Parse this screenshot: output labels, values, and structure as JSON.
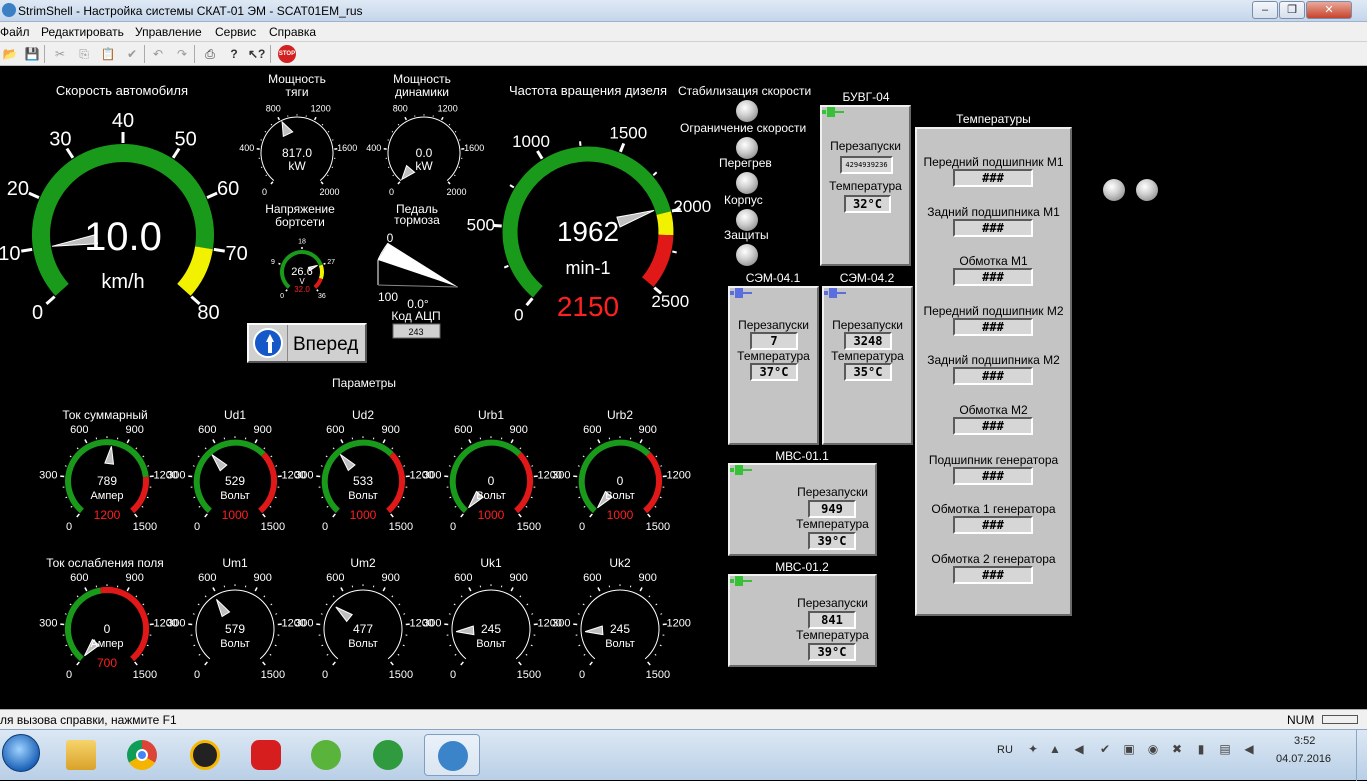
{
  "window": {
    "title": "StrimShell - Настройка системы СКАТ-01 ЭМ - SCAT01EM_rus",
    "controls": [
      "–",
      "❐",
      "✕"
    ]
  },
  "menu": [
    "Файл",
    "Редактировать",
    "Управление",
    "Сервис",
    "Справка"
  ],
  "toolbar": [
    "open-icon",
    "save-icon",
    "cut-icon",
    "copy-icon",
    "paste-icon",
    "check-icon",
    "undo-icon",
    "redo-icon",
    "print-icon",
    "help-icon",
    "context-help-icon",
    "stop-icon"
  ],
  "speed": {
    "title": "Скорость автомобиля",
    "value": "10.0",
    "unit": "km/h",
    "ticks": [
      "0",
      "10",
      "20",
      "30",
      "40",
      "50",
      "60",
      "70",
      "80"
    ]
  },
  "traction_power": {
    "title1": "Мощность",
    "title2": "тяги",
    "value": "817.0",
    "unit": "kW",
    "ticks": [
      "0",
      "400",
      "800",
      "1200",
      "1600",
      "2000"
    ]
  },
  "dynamic_power": {
    "title1": "Мощность",
    "title2": "динамики",
    "value": "0.0",
    "unit": "kW",
    "ticks": [
      "0",
      "400",
      "800",
      "1200",
      "1600",
      "2000"
    ]
  },
  "board_voltage": {
    "title1": "Напряжение",
    "title2": "бортсети",
    "value": "26.6",
    "unit": "V",
    "limit": "32.0",
    "ticks": [
      "0",
      "9",
      "18",
      "27",
      "36"
    ]
  },
  "brake_pedal": {
    "title1": "Педаль",
    "title2": "тормоза",
    "angle": "0.0°",
    "adc_label": "Код АЦП",
    "adc_value": "243",
    "ticks": [
      "0",
      "100"
    ]
  },
  "direction": {
    "label": "Вперед"
  },
  "diesel": {
    "title": "Частота вращения дизеля",
    "value": "1962",
    "unit": "min-1",
    "limit": "2150",
    "ticks": [
      "0",
      "500",
      "1000",
      "1500",
      "2000",
      "2500"
    ]
  },
  "stabilization": {
    "items": [
      "Стабилизация скорости",
      "Ограничение скорости",
      "Перегрев",
      "Корпус",
      "Защиты"
    ]
  },
  "buvg": {
    "title": "БУВГ-04",
    "restarts_label": "Перезапуски",
    "restarts": "4294939236",
    "temp_label": "Температура",
    "temp": "32°C"
  },
  "sem1": {
    "title": "СЭМ-04.1",
    "restarts_label": "Перезапуски",
    "restarts": "7",
    "temp_label": "Температура",
    "temp": "37°C"
  },
  "sem2": {
    "title": "СЭМ-04.2",
    "restarts_label": "Перезапуски",
    "restarts": "3248",
    "temp_label": "Температура",
    "temp": "35°C"
  },
  "mvs1": {
    "title": "МВС-01.1",
    "restarts_label": "Перезапуски",
    "restarts": "949",
    "temp_label": "Температура",
    "temp": "39°C"
  },
  "mvs2": {
    "title": "МВС-01.2",
    "restarts_label": "Перезапуски",
    "restarts": "841",
    "temp_label": "Температура",
    "temp": "39°C"
  },
  "temperatures": {
    "title": "Температуры",
    "items": [
      {
        "label": "Передний подшипник М1",
        "value": "###"
      },
      {
        "label": "Задний подшипника М1",
        "value": "###"
      },
      {
        "label": "Обмотка М1",
        "value": "###"
      },
      {
        "label": "Передний подшипник М2",
        "value": "###"
      },
      {
        "label": "Задний подшипника М2",
        "value": "###"
      },
      {
        "label": "Обмотка М2",
        "value": "###"
      },
      {
        "label": "Подшипник генератора",
        "value": "###"
      },
      {
        "label": "Обмотка 1 генератора",
        "value": "###"
      },
      {
        "label": "Обмотка 2 генератора",
        "value": "###"
      }
    ]
  },
  "params_title": "Параметры",
  "small_gauges": [
    {
      "title": "Ток суммарный",
      "value": "789",
      "unit": "Ампер",
      "limit": "1200",
      "ticks": [
        "0",
        "300",
        "600",
        "900",
        "1200",
        "1500"
      ]
    },
    {
      "title": "Ud1",
      "value": "529",
      "unit": "Вольт",
      "limit": "1000",
      "ticks": [
        "0",
        "300",
        "600",
        "900",
        "1200",
        "1500"
      ]
    },
    {
      "title": "Ud2",
      "value": "533",
      "unit": "Вольт",
      "limit": "1000",
      "ticks": [
        "0",
        "300",
        "600",
        "900",
        "1200",
        "1500"
      ]
    },
    {
      "title": "Urb1",
      "value": "0",
      "unit": "Вольт",
      "limit": "1000",
      "ticks": [
        "0",
        "300",
        "600",
        "900",
        "1200",
        "1500"
      ]
    },
    {
      "title": "Urb2",
      "value": "0",
      "unit": "Вольт",
      "limit": "1000",
      "ticks": [
        "0",
        "300",
        "600",
        "900",
        "1200",
        "1500"
      ]
    },
    {
      "title": "Ток ослабления поля",
      "value": "0",
      "unit": "Ампер",
      "limit": "700",
      "ticks": [
        "0",
        "300",
        "600",
        "900",
        "1200",
        "1500"
      ]
    },
    {
      "title": "Um1",
      "value": "579",
      "unit": "Вольт",
      "limit": "",
      "ticks": [
        "0",
        "300",
        "600",
        "900",
        "1200",
        "1500"
      ]
    },
    {
      "title": "Um2",
      "value": "477",
      "unit": "Вольт",
      "limit": "",
      "ticks": [
        "0",
        "300",
        "600",
        "900",
        "1200",
        "1500"
      ]
    },
    {
      "title": "Uk1",
      "value": "245",
      "unit": "Вольт",
      "limit": "",
      "ticks": [
        "0",
        "300",
        "600",
        "900",
        "1200",
        "1500"
      ]
    },
    {
      "title": "Uk2",
      "value": "245",
      "unit": "Вольт",
      "limit": "",
      "ticks": [
        "0",
        "300",
        "600",
        "900",
        "1200",
        "1500"
      ]
    }
  ],
  "statusbar": {
    "hint": "ля вызова справки, нажмите F1",
    "num": "NUM"
  },
  "taskbar": {
    "lang": "RU",
    "time": "3:52",
    "date": "04.07.2016",
    "apps": [
      "start-orb-icon",
      "file-explorer-icon",
      "chrome-icon",
      "archicad-icon",
      "opera-icon",
      "utorrent-icon",
      "network-app-icon",
      "strimshell-icon"
    ]
  },
  "colors": {
    "ok": "#1a9a1a",
    "warn": "#f2f200",
    "alarm": "#e01818",
    "limit_text": "#ff2020"
  }
}
